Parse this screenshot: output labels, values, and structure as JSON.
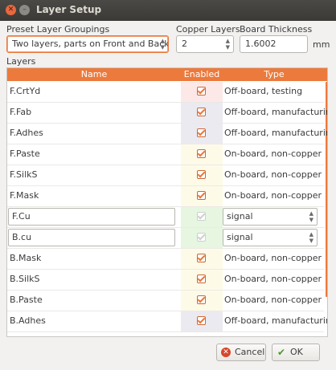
{
  "window": {
    "title": "Layer Setup"
  },
  "preset": {
    "label": "Preset Layer Groupings",
    "value": "Two layers, parts on Front and Back"
  },
  "copper": {
    "label": "Copper Layers",
    "value": "2"
  },
  "thickness": {
    "label": "Board Thickness",
    "value": "1.6002",
    "unit": "mm"
  },
  "layers_label": "Layers",
  "table": {
    "headers": {
      "name": "Name",
      "enabled": "Enabled",
      "type": "Type"
    },
    "rows": [
      {
        "name": "F.CrtYd",
        "enabled": true,
        "type": "Off-board, testing",
        "bg": "#fde8e8"
      },
      {
        "name": "F.Fab",
        "enabled": true,
        "type": "Off-board, manufacturing",
        "bg": "#ebeaf0"
      },
      {
        "name": "F.Adhes",
        "enabled": true,
        "type": "Off-board, manufacturing",
        "bg": "#ebeaf0"
      },
      {
        "name": "F.Paste",
        "enabled": true,
        "type": "On-board, non-copper",
        "bg": "#fdfbe8"
      },
      {
        "name": "F.SilkS",
        "enabled": true,
        "type": "On-board, non-copper",
        "bg": "#fdfbe8"
      },
      {
        "name": "F.Mask",
        "enabled": true,
        "type": "On-board, non-copper",
        "bg": "#fdfbe8"
      },
      {
        "name": "F.Cu",
        "enabled": true,
        "type": "signal",
        "bg": "#e6f6e0"
      },
      {
        "name": "B.cu",
        "enabled": true,
        "type": "signal",
        "bg": "#e6f6e0"
      },
      {
        "name": "B.Mask",
        "enabled": true,
        "type": "On-board, non-copper",
        "bg": "#fdfbe8"
      },
      {
        "name": "B.SilkS",
        "enabled": true,
        "type": "On-board, non-copper",
        "bg": "#fdfbe8"
      },
      {
        "name": "B.Paste",
        "enabled": true,
        "type": "On-board, non-copper",
        "bg": "#fdfbe8"
      },
      {
        "name": "B.Adhes",
        "enabled": true,
        "type": "Off-board, manufacturing",
        "bg": "#ebeaf0"
      }
    ]
  },
  "buttons": {
    "cancel": "Cancel",
    "ok": "OK"
  },
  "colors": {
    "accent": "#ec7a3c",
    "titlebar": "#3b3a36"
  }
}
